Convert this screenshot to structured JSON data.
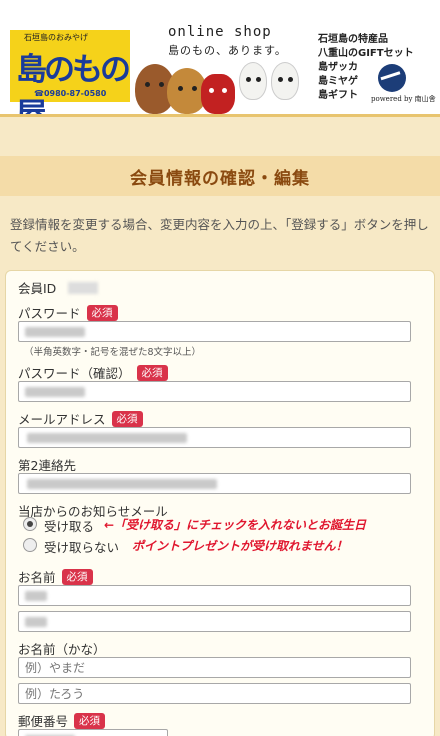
{
  "header": {
    "logo_small": "石垣島のおみやげ",
    "logo_main": "島のもの屋",
    "logo_phone": "☎0980-87-0580",
    "shop_title": "online shop",
    "shop_sub": "島のもの、あります。",
    "side_lines": [
      "石垣島の特産品",
      "八重山のGIFTセット",
      "島ザッカ",
      "島ミヤゲ",
      "島ギフト"
    ],
    "powered_by": "powered by 南山舎"
  },
  "page": {
    "title": "会員情報の確認・編集",
    "intro": "登録情報を変更する場合、変更内容を入力の上、「登録する」ボタンを押してください。"
  },
  "form": {
    "required_badge": "必須",
    "member_id_label": "会員ID",
    "password_label": "パスワード",
    "password_hint": "（半角英数字・記号を混ぜた8文字以上）",
    "password_confirm_label": "パスワード（確認）",
    "email_label": "メールアドレス",
    "secondary_contact_label": "第2連絡先",
    "newsletter_label": "当店からのお知らせメール",
    "newsletter_options": [
      "受け取る",
      "受け取らない"
    ],
    "newsletter_selected": "受け取る",
    "annotation_line1": "←「受け取る」にチェックを入れないとお誕生日",
    "annotation_line2": "ポイントプレゼントが受け取れません！",
    "name_label": "お名前",
    "name_kana_label": "お名前（かな）",
    "kana_last_placeholder": "例）やまだ",
    "kana_first_placeholder": "例）たろう",
    "postal_label": "郵便番号"
  },
  "colors": {
    "background": "#f7e9c6",
    "title_text": "#8a4a10",
    "required_badge": "#d9334a",
    "annotation": "#e0162e"
  }
}
